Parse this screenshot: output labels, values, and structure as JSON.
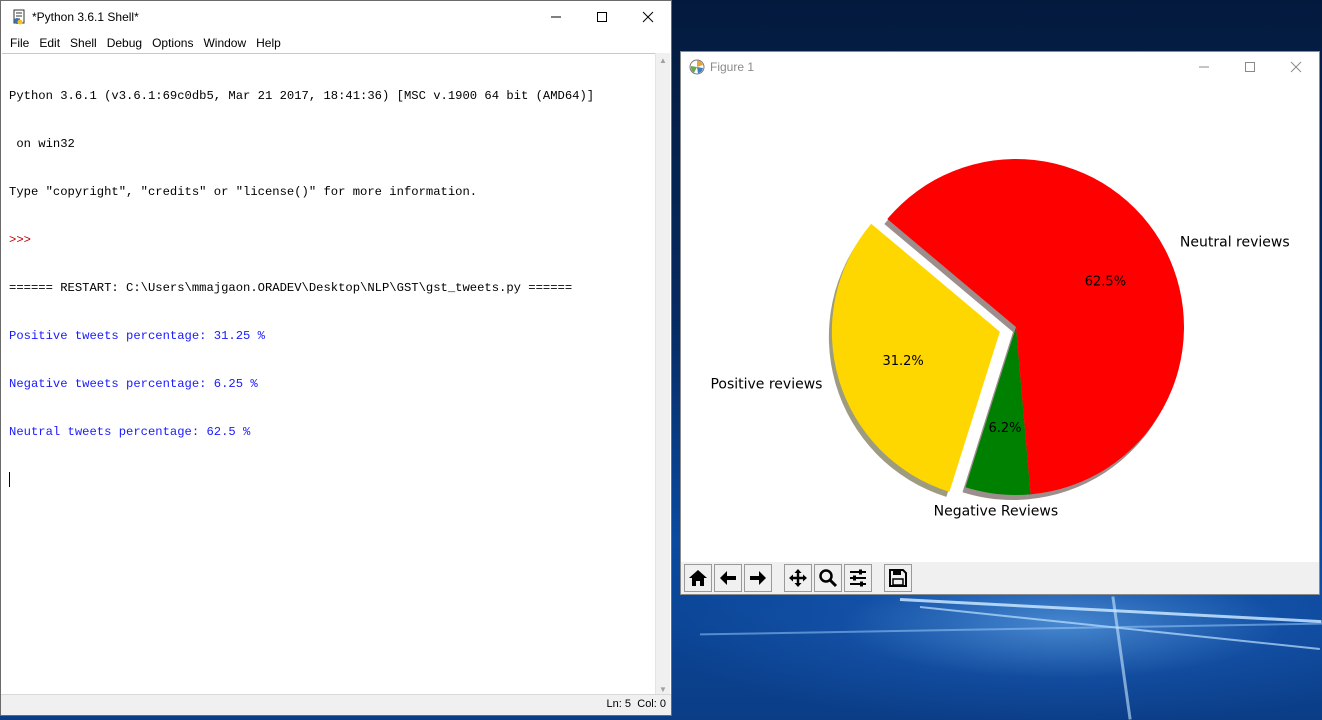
{
  "idle": {
    "title": "*Python 3.6.1 Shell*",
    "controls": {
      "minimize": "—",
      "maximize": "☐",
      "close": "✕"
    },
    "menu": [
      "File",
      "Edit",
      "Shell",
      "Debug",
      "Options",
      "Window",
      "Help"
    ],
    "shell_lines": [
      {
        "text": "Python 3.6.1 (v3.6.1:69c0db5, Mar 21 2017, 18:41:36) [MSC v.1900 64 bit (AMD64)]",
        "kind": "plain"
      },
      {
        "text": " on win32",
        "kind": "plain"
      },
      {
        "text": "Type \"copyright\", \"credits\" or \"license()\" for more information.",
        "kind": "plain"
      },
      {
        "text": ">>> ",
        "kind": "prompt"
      },
      {
        "text": "====== RESTART: C:\\Users\\mmajgaon.ORADEV\\Desktop\\NLP\\GST\\gst_tweets.py ======",
        "kind": "plain"
      },
      {
        "text": "Positive tweets percentage: 31.25 %",
        "kind": "out"
      },
      {
        "text": "Negative tweets percentage: 6.25 %",
        "kind": "out"
      },
      {
        "text": "Neutral tweets percentage: 62.5 %",
        "kind": "out"
      }
    ],
    "status": {
      "ln": "Ln: 5",
      "col": "Col: 0"
    }
  },
  "figure": {
    "title": "Figure 1",
    "toolbar": [
      "home-icon",
      "back-arrow-icon",
      "forward-arrow-icon",
      "pan-icon",
      "zoom-icon",
      "configure-subplots-icon",
      "save-icon"
    ]
  },
  "chart_data": {
    "type": "pie",
    "slices": [
      {
        "label": "Positive reviews",
        "value": 31.25,
        "pct_label": "31.2%",
        "color": "#ffd700",
        "explode": true
      },
      {
        "label": "Negative Reviews",
        "value": 6.25,
        "pct_label": "6.2%",
        "color": "#008000",
        "explode": false
      },
      {
        "label": "Neutral reviews",
        "value": 62.5,
        "pct_label": "62.5%",
        "color": "#ff0000",
        "explode": false
      }
    ],
    "startangle_deg": 140,
    "shadow": true,
    "title": ""
  }
}
